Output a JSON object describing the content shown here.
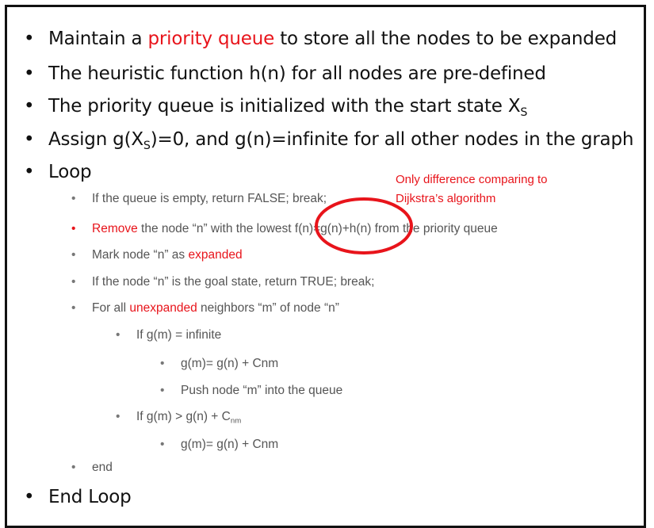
{
  "bullets_main": {
    "b1_pre": "Maintain a ",
    "b1_red": "priority queue",
    "b1_post": " to store all the nodes to be expanded",
    "b2": "The heuristic function h(n) for all nodes are pre-defined",
    "b3_pre": "The priority queue is initialized with the start state X",
    "b3_sub": "S",
    "b4_pre": "Assign g(X",
    "b4_sub": "S",
    "b4_post": ")=0, and g(n)=infinite for all other nodes in the graph",
    "b5": "Loop",
    "b6": "End Loop"
  },
  "loop": {
    "l1": "If the queue is empty, return FALSE; break;",
    "l2_red": "Remove",
    "l2_post": " the node “n” with the lowest f(n)=g(n)+h(n) from the priority queue",
    "l3_pre": "Mark node “n” as ",
    "l3_red": "expanded",
    "l4": "If the node “n” is the goal state, return TRUE; break;",
    "l5_pre": "For all ",
    "l5_red": "unexpanded",
    "l5_post": " neighbors “m” of node “n”",
    "l6": "If g(m) = infinite",
    "l7": "g(m)= g(n) + Cnm",
    "l8": "Push node “m” into the queue",
    "l9_pre": "If g(m) > g(n) + C",
    "l9_sub": "nm",
    "l10": "g(m)= g(n) + Cnm",
    "l11": "end"
  },
  "annotation": {
    "line1": "Only difference comparing to",
    "line2": "Dijkstra’s algorithm",
    "circle_color": "#e8141b"
  },
  "bullet_glyph": "•"
}
